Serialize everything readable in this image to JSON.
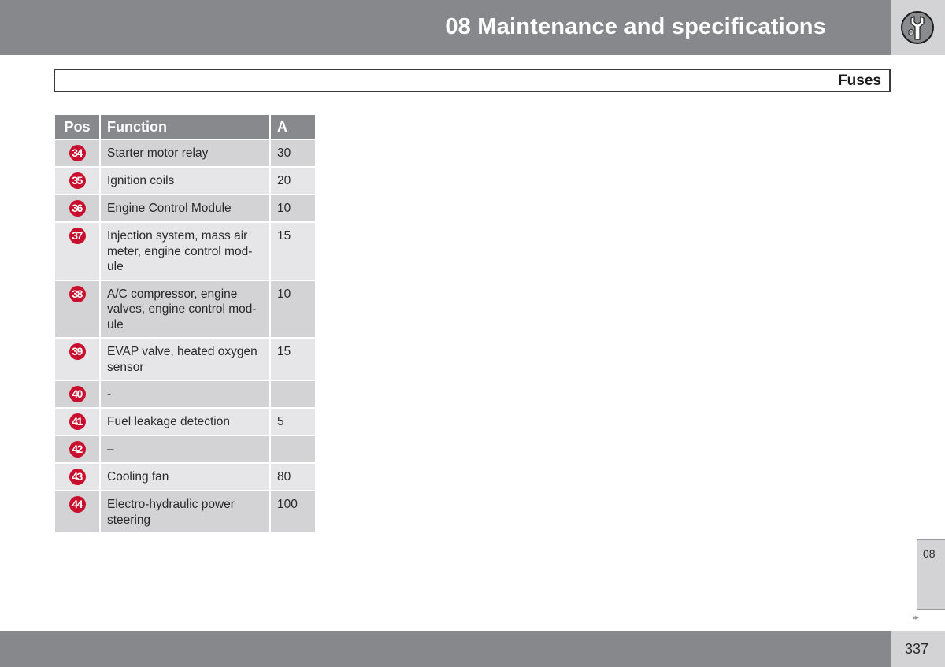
{
  "header": {
    "chapter_title": "08 Maintenance and specifications",
    "chapter_icon": "wrench-nut-icon"
  },
  "section": {
    "title": "Fuses"
  },
  "table": {
    "columns": [
      "Pos",
      "Function",
      "A"
    ],
    "rows": [
      {
        "pos": "34",
        "function": "Starter motor relay",
        "amps": "30"
      },
      {
        "pos": "35",
        "function": "Ignition coils",
        "amps": "20"
      },
      {
        "pos": "36",
        "function": "Engine Control Module",
        "amps": "10"
      },
      {
        "pos": "37",
        "function": "Injection system, mass air meter, engine control mod-ule",
        "amps": "15"
      },
      {
        "pos": "38",
        "function": "A/C compressor, engine valves, engine control mod-ule",
        "amps": "10"
      },
      {
        "pos": "39",
        "function": "EVAP valve, heated oxygen sensor",
        "amps": "15"
      },
      {
        "pos": "40",
        "function": "-",
        "amps": ""
      },
      {
        "pos": "41",
        "function": "Fuel leakage detection",
        "amps": "5"
      },
      {
        "pos": "42",
        "function": "–",
        "amps": ""
      },
      {
        "pos": "43",
        "function": "Cooling fan",
        "amps": "80"
      },
      {
        "pos": "44",
        "function": "Electro-hydraulic power steering",
        "amps": "100"
      }
    ]
  },
  "side_tab": {
    "label": "08",
    "next_icon": "double-arrow-right-icon",
    "next_glyph": "▸▸"
  },
  "footer": {
    "page_number": "337"
  },
  "colors": {
    "header_gray": "#87888c",
    "light_gray": "#d3d3d5",
    "badge_red": "#c8102e"
  }
}
